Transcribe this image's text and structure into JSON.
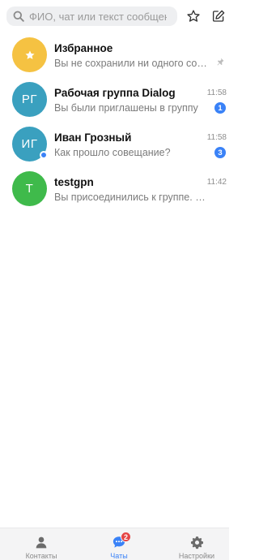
{
  "search": {
    "placeholder": "ФИО, чат или текст сообщения",
    "value": ""
  },
  "colors": {
    "accent": "#3a82f7",
    "favorites_avatar": "#f5c242",
    "teal_avatar": "#3aa0bf",
    "green_avatar": "#3fba4b",
    "tab_badge": "#e54545"
  },
  "chats": [
    {
      "name": "Избранное",
      "preview": "Вы не сохранили ни одного сообщения",
      "time": "",
      "badge": "",
      "avatar_icon": "star-icon",
      "pinned": true
    },
    {
      "name": "Рабочая группа Dialog",
      "preview": "Вы были приглашены в группу",
      "time": "11:58",
      "badge": "1",
      "avatar_initials": "РГ"
    },
    {
      "name": "Иван Грозный",
      "preview": "Как прошло совещание?",
      "time": "11:58",
      "badge": "3",
      "avatar_initials": "ИГ",
      "online": true
    },
    {
      "name": "testgpn",
      "preview": "Вы присоединились к группе. Отправьте сообщение",
      "time": "11:42",
      "badge": "",
      "avatar_initials": "T"
    }
  ],
  "bottom_nav": {
    "contacts": {
      "label": "Контакты",
      "icon": "person-icon"
    },
    "chats": {
      "label": "Чаты",
      "icon": "chat-bubble-icon",
      "badge": "2",
      "active": true
    },
    "settings": {
      "label": "Настройки",
      "icon": "gear-icon"
    }
  }
}
